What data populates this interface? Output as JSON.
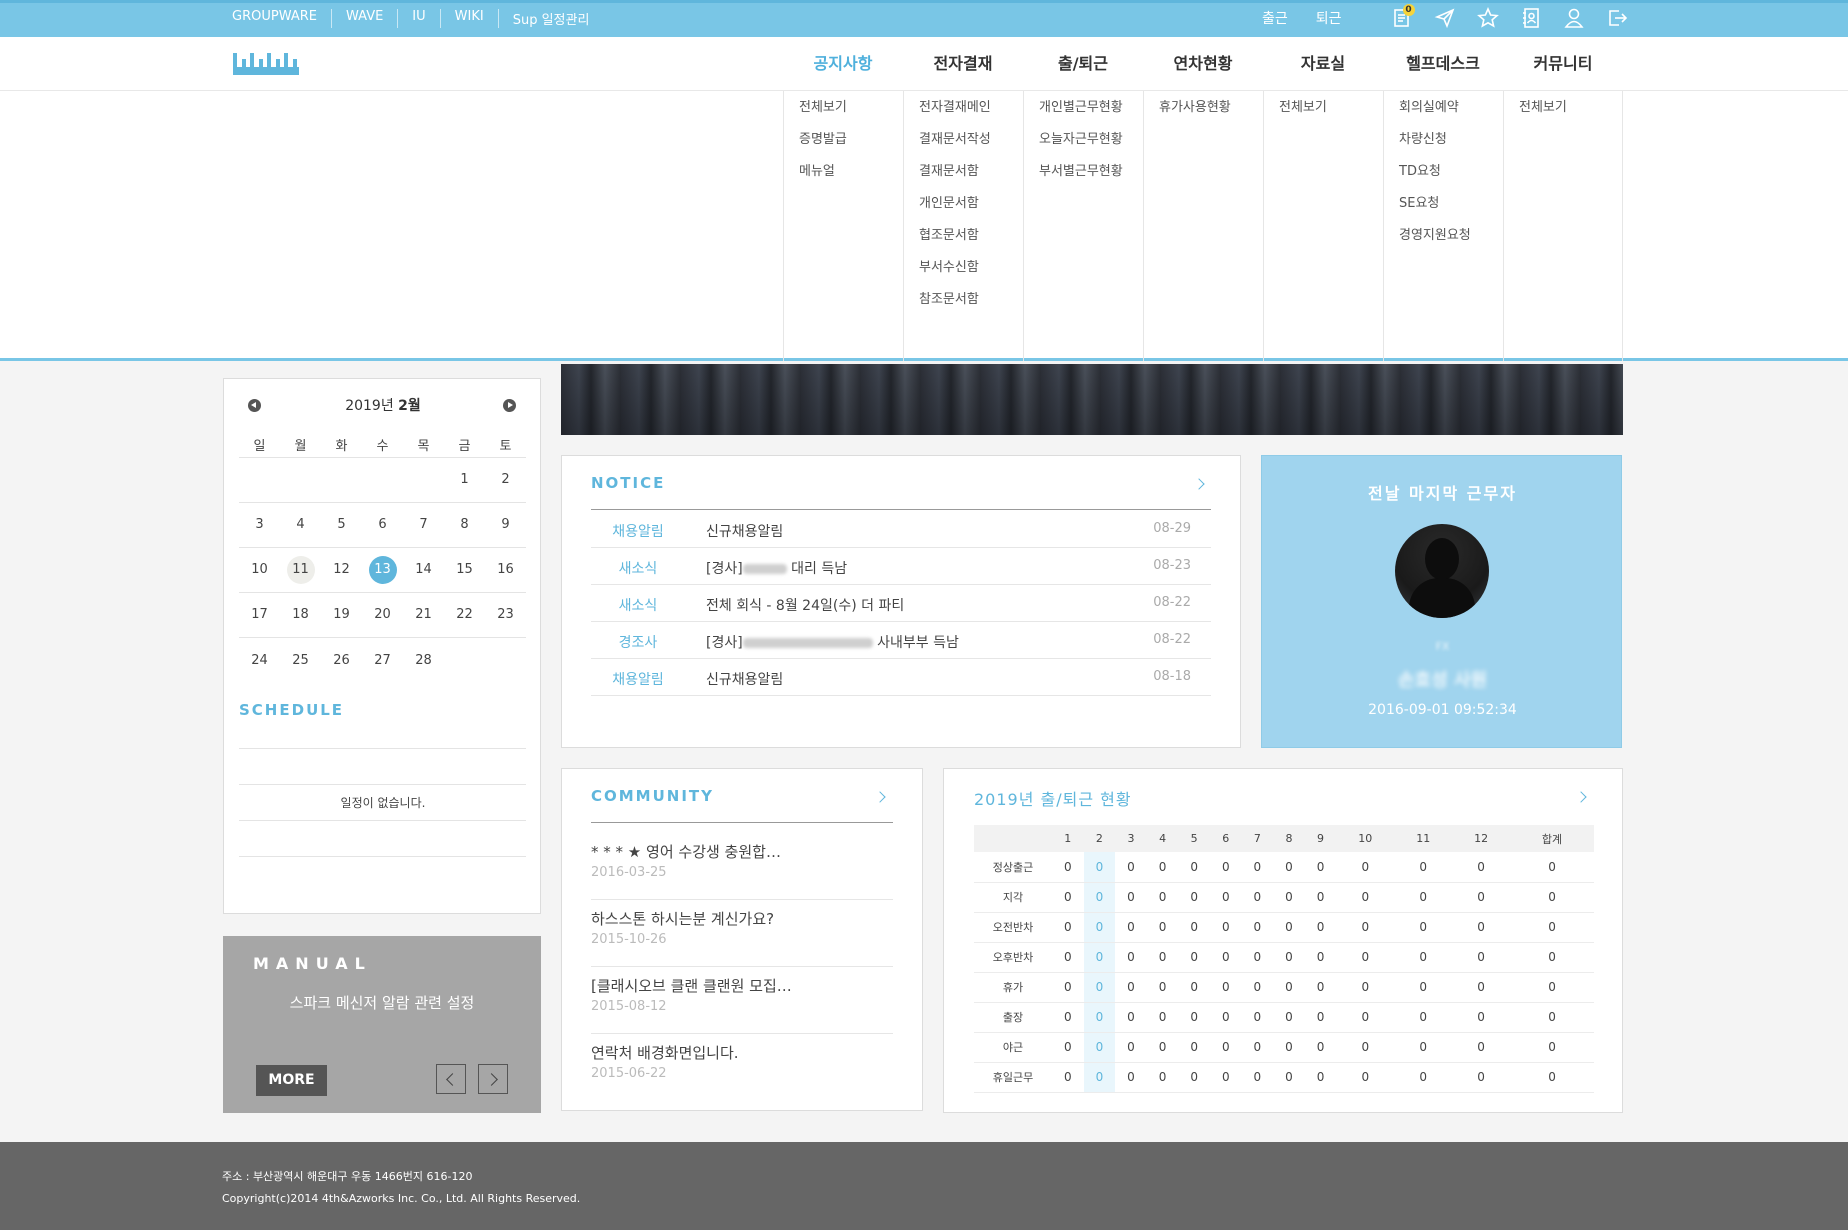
{
  "top_bar": {
    "links": [
      "GROUPWARE",
      "WAVE",
      "IU",
      "WIKI",
      "Sup 일정관리"
    ],
    "check_in": "출근",
    "check_out": "퇴근",
    "notice_badge": "0"
  },
  "nav": {
    "menus": [
      "공지사항",
      "전자결재",
      "출/퇴근",
      "연차현황",
      "자료실",
      "헬프데스크",
      "커뮤니티"
    ],
    "dropdown": [
      [
        "전체보기",
        "증명발급",
        "메뉴얼"
      ],
      [
        "전자결재메인",
        "결재문서작성",
        "결재문서함",
        "개인문서함",
        "협조문서함",
        "부서수신함",
        "참조문서함"
      ],
      [
        "개인별근무현황",
        "오늘자근무현황",
        "부서별근무현황"
      ],
      [
        "휴가사용현황"
      ],
      [
        "전체보기"
      ],
      [
        "회의실예약",
        "차량신청",
        "TD요청",
        "SE요청",
        "경영지원요청"
      ],
      [
        "전체보기"
      ]
    ]
  },
  "calendar": {
    "year_label": "2019년",
    "month_label": "2월",
    "weekdays": [
      "일",
      "월",
      "화",
      "수",
      "목",
      "금",
      "토"
    ],
    "weeks": [
      [
        "",
        "",
        "",
        "",
        "",
        "1",
        "2"
      ],
      [
        "3",
        "4",
        "5",
        "6",
        "7",
        "8",
        "9"
      ],
      [
        "10",
        "11",
        "12",
        "13",
        "14",
        "15",
        "16"
      ],
      [
        "17",
        "18",
        "19",
        "20",
        "21",
        "22",
        "23"
      ],
      [
        "24",
        "25",
        "26",
        "27",
        "28",
        "",
        ""
      ]
    ],
    "selected_day": "11",
    "today": "13"
  },
  "schedule": {
    "title": "SCHEDULE",
    "empty_text": "일정이 없습니다."
  },
  "manual": {
    "title": "MANUAL",
    "text": "스파크 메신저 알람 관련 설정",
    "more_label": "MORE"
  },
  "notice": {
    "title": "NOTICE",
    "items": [
      {
        "category": "채용알림",
        "title": "신규채용알림",
        "date": "08-29"
      },
      {
        "category": "새소식",
        "title_prefix": "[경사]",
        "title_suffix": " 대리 득남",
        "date": "08-23"
      },
      {
        "category": "새소식",
        "title": "전체 회식 - 8월 24일(수) 더 파티",
        "date": "08-22"
      },
      {
        "category": "경조사",
        "title_prefix": "[경사]",
        "title_suffix": " 사내부부 득남",
        "date": "08-22"
      },
      {
        "category": "채용알림",
        "title": "신규채용알림",
        "date": "08-18"
      }
    ]
  },
  "last_worker": {
    "title": "전날 마지막 근무자",
    "dept": "FX",
    "name": "손효성 사원",
    "time": "2016-09-01 09:52:34"
  },
  "community": {
    "title": "COMMUNITY",
    "items": [
      {
        "title": "* * * ★ 영어 수강생 충원합…",
        "date": "2016-03-25"
      },
      {
        "title": "하스스톤 하시는분 계신가요?",
        "date": "2015-10-26"
      },
      {
        "title": "[클래시오브 클랜 클랜원 모집…",
        "date": "2015-08-12"
      },
      {
        "title": "연락처 배경화면입니다.",
        "date": "2015-06-22"
      }
    ]
  },
  "attendance": {
    "title": "2019년 출/퇴근 현황",
    "columns": [
      "",
      "1",
      "2",
      "3",
      "4",
      "5",
      "6",
      "7",
      "8",
      "9",
      "10",
      "11",
      "12",
      "합계"
    ],
    "rows": [
      {
        "label": "정상출근",
        "values": [
          "0",
          "0",
          "0",
          "0",
          "0",
          "0",
          "0",
          "0",
          "0",
          "0",
          "0",
          "0",
          "0"
        ]
      },
      {
        "label": "지각",
        "values": [
          "0",
          "0",
          "0",
          "0",
          "0",
          "0",
          "0",
          "0",
          "0",
          "0",
          "0",
          "0",
          "0"
        ]
      },
      {
        "label": "오전반차",
        "values": [
          "0",
          "0",
          "0",
          "0",
          "0",
          "0",
          "0",
          "0",
          "0",
          "0",
          "0",
          "0",
          "0"
        ]
      },
      {
        "label": "오후반차",
        "values": [
          "0",
          "0",
          "0",
          "0",
          "0",
          "0",
          "0",
          "0",
          "0",
          "0",
          "0",
          "0",
          "0"
        ]
      },
      {
        "label": "휴가",
        "values": [
          "0",
          "0",
          "0",
          "0",
          "0",
          "0",
          "0",
          "0",
          "0",
          "0",
          "0",
          "0",
          "0"
        ]
      },
      {
        "label": "출장",
        "values": [
          "0",
          "0",
          "0",
          "0",
          "0",
          "0",
          "0",
          "0",
          "0",
          "0",
          "0",
          "0",
          "0"
        ]
      },
      {
        "label": "야근",
        "values": [
          "0",
          "0",
          "0",
          "0",
          "0",
          "0",
          "0",
          "0",
          "0",
          "0",
          "0",
          "0",
          "0"
        ]
      },
      {
        "label": "휴일근무",
        "values": [
          "0",
          "0",
          "0",
          "0",
          "0",
          "0",
          "0",
          "0",
          "0",
          "0",
          "0",
          "0",
          "0"
        ]
      }
    ],
    "current_month": "2"
  },
  "footer": {
    "address": "주소 : 부산광역시 해운대구 우동 1466번지 616-120",
    "copyright": "Copyright(c)2014 4th&Azworks Inc. Co., Ltd. All Rights Reserved."
  },
  "colors": {
    "accent": "#5fb6dc",
    "topbar": "#79c6e6",
    "last_worker_bg": "#a0d4ee",
    "footer_bg": "#666666",
    "manual_bg": "#a6a6a6"
  }
}
